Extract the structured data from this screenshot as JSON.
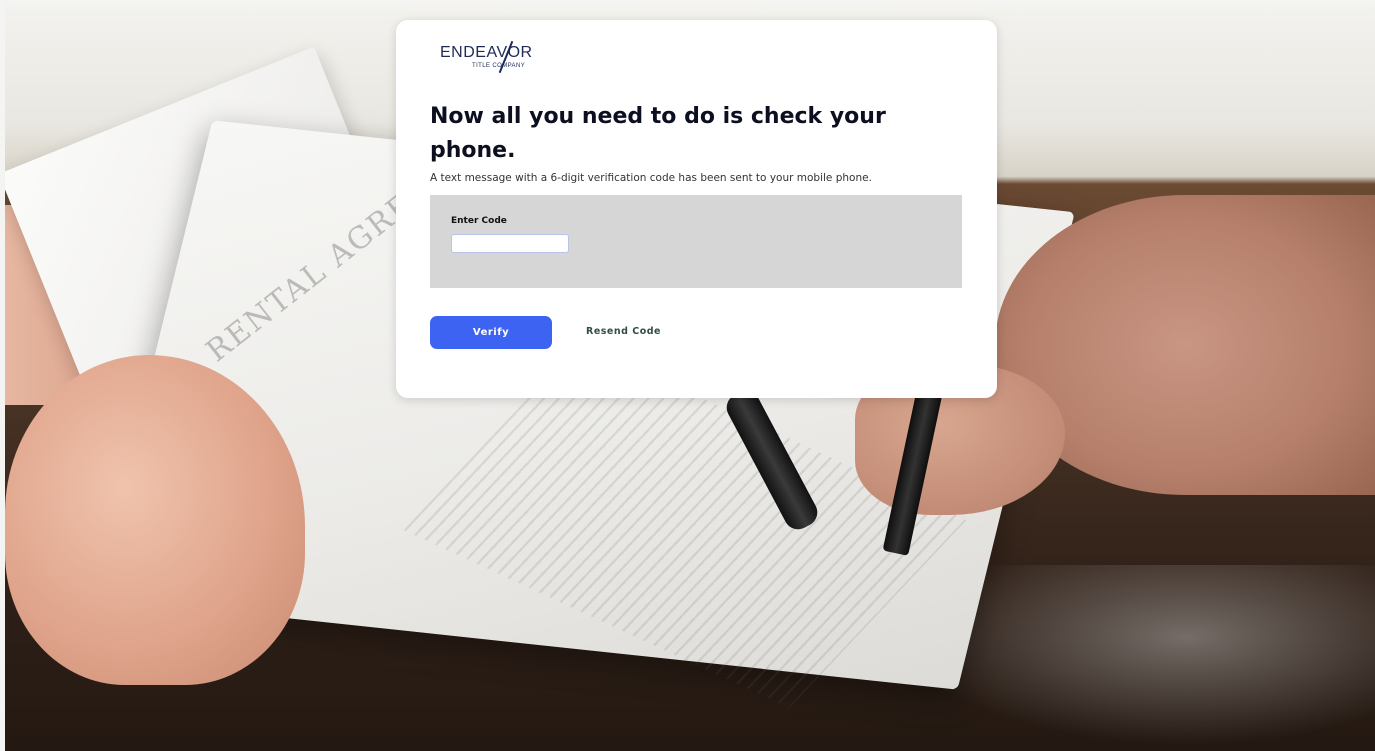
{
  "logo": {
    "name": "ENDEAVOR",
    "tagline": "TITLE COMPANY"
  },
  "verification": {
    "heading": "Now all you need to do is check your phone.",
    "description": "A text message with a 6-digit verification code has been sent to your mobile phone.",
    "code_label": "Enter Code",
    "code_value": "",
    "code_placeholder": "",
    "verify_label": "Verify",
    "resend_label": "Resend Code"
  },
  "colors": {
    "primary_button": "#3d63f2",
    "panel_background": "#d6d6d6",
    "resend_link": "#2f4f3f",
    "brand_navy": "#1e2a57"
  },
  "background": {
    "document_title": "RENTAL AGREEMENT"
  }
}
